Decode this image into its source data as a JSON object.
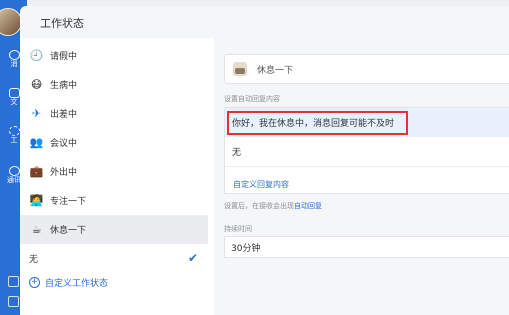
{
  "dialog": {
    "title": "工作状态"
  },
  "rail": {
    "items": [
      "消",
      "文",
      "工",
      "通讯"
    ]
  },
  "statuses": [
    {
      "label": "请假中",
      "icon": "clock-icon",
      "glyph": "🕘"
    },
    {
      "label": "生病中",
      "icon": "sick-face-icon",
      "glyph": "😷"
    },
    {
      "label": "出差中",
      "icon": "airplane-icon",
      "glyph": "✈"
    },
    {
      "label": "会议中",
      "icon": "meeting-icon",
      "glyph": "👥"
    },
    {
      "label": "外出中",
      "icon": "briefcase-icon",
      "glyph": "💼"
    },
    {
      "label": "专注一下",
      "icon": "focus-icon",
      "glyph": "🧑‍💻"
    },
    {
      "label": "休息一下",
      "icon": "coffee-icon",
      "glyph": "☕"
    },
    {
      "label": "无",
      "icon": "",
      "glyph": ""
    }
  ],
  "selected_status": "无",
  "add_status_label": "自定义工作状态",
  "right": {
    "status_value": "休息一下",
    "reply_label": "设置自动回复内容",
    "reply_options": [
      "你好，我在休息中，消息回复可能不及时",
      "无"
    ],
    "custom_reply_label": "自定义回复内容",
    "note_prefix": "设置后，在接收会出现",
    "note_link": "自动回复",
    "duration_label": "持续时间",
    "duration_value": "30分钟"
  },
  "colors": {
    "accent": "#2a6fd6",
    "highlight_border": "#e5322d",
    "selected_bg": "#e8f1fd"
  }
}
